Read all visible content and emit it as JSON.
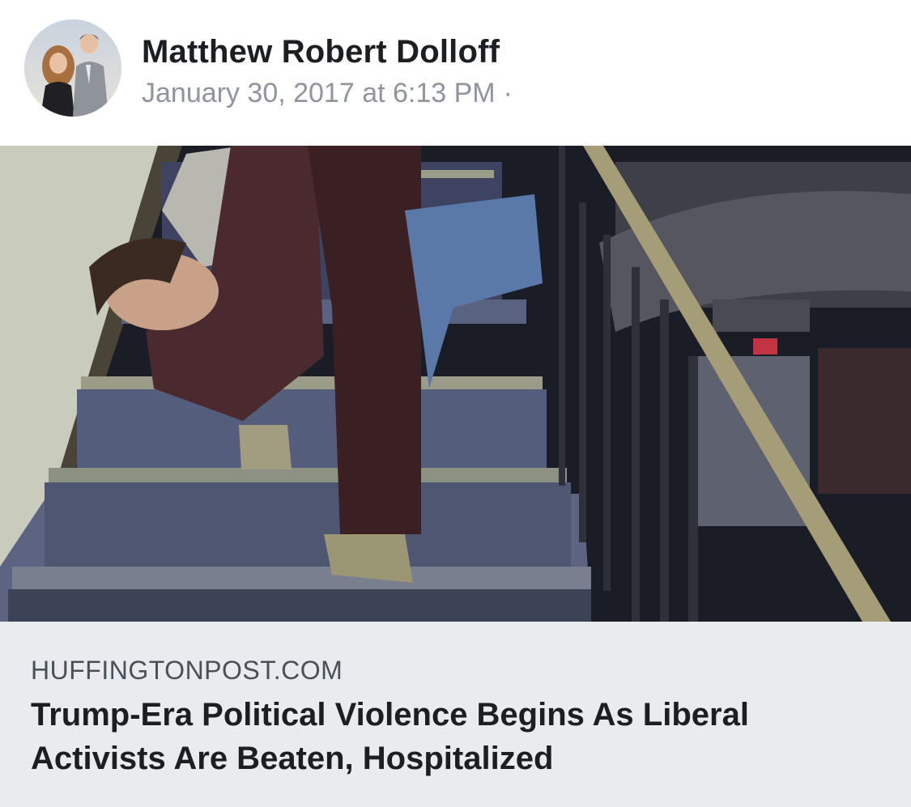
{
  "post": {
    "author": "Matthew Robert Dolloff",
    "timestamp": "January 30, 2017 at 6:13 PM",
    "separator": "·",
    "avatar_icon": "couple-profile-photo"
  },
  "link_preview": {
    "image_description_icon": "photo-man-held-on-stairs",
    "domain": "HUFFINGTONPOST.COM",
    "title": "Trump-Era Political Violence Begins As Liberal Activists Are Beaten, Hospitalized"
  },
  "colors": {
    "name_text": "#1c1e21",
    "meta_text": "#90949c",
    "caption_bg": "#e9ebee",
    "domain_text": "#4b4f56"
  }
}
